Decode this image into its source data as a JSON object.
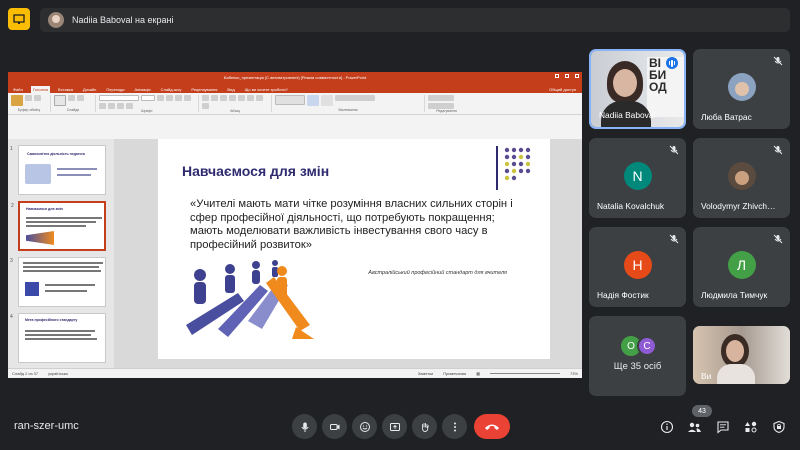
{
  "header": {
    "presenting_text": "Nadiia Baboval на екрані"
  },
  "ppt": {
    "window_title": "Бабенко_презентація (С автовзтровлені) [Режим совместности] - PowerPoint",
    "tabs": [
      "Файл",
      "Головна",
      "Вставка",
      "Дизайн",
      "Переходи",
      "Анімація",
      "Слайд-шоу",
      "Рецензування",
      "Вид",
      "Що ви хочете зробити?"
    ],
    "share_label": "Общий доступ",
    "groups": [
      "Буфер обміну",
      "Слайди",
      "Шрифт",
      "Абзац",
      "Малювання",
      "Редагування"
    ],
    "slide_title": "Навчаємося для змін",
    "slide_quote": "«Учителі мають мати чітке розуміння власних сильних сторін і сфер професійної діяльності, що потребують покращення; мають моделювати важливість інвестування свого часу в професійний розвиток»",
    "slide_cite": "Австралійський професійний стандарт для вчителя",
    "thumb_titles": [
      "Самоосвітня діяльність педагога",
      "Навчаємося для змін",
      "",
      "Мета професійного стандарту"
    ],
    "thumb_numbers": [
      "1",
      "2",
      "3",
      "4"
    ],
    "status_left": "Слайд 2 из 37",
    "status_lang": "українська",
    "status_notes": "Заметки",
    "status_comments": "Примечания",
    "zoom": "73%"
  },
  "participants": {
    "presenter": "Nadiia Baboval",
    "others": [
      {
        "name": "Люба Ватрас",
        "photo": true
      },
      {
        "name": "Natalia Kovalchuk",
        "initial": "N",
        "color": "#00897b"
      },
      {
        "name": "Volodymyr Zhivch…",
        "photo": true
      },
      {
        "name": "Надія Фостик",
        "initial": "Н",
        "color": "#e64a19"
      },
      {
        "name": "Людмила Тимчук",
        "initial": "Л",
        "color": "#43a047"
      }
    ],
    "more_label": "Ще 35 осіб",
    "more_initials": [
      {
        "initial": "O",
        "color": "#43a047"
      },
      {
        "initial": "C",
        "color": "#8e5bd4"
      }
    ],
    "self_label": "Ви"
  },
  "bottom_bar": {
    "meeting_code": "ran-szer-umc",
    "participant_count": "43",
    "controls": [
      "mic-icon",
      "camera-icon",
      "emoji-icon",
      "present-icon",
      "raise-hand-icon",
      "more-icon",
      "end-call-icon"
    ],
    "right_icons": [
      "info-icon",
      "people-icon",
      "chat-icon",
      "activities-icon",
      "host-controls-icon"
    ]
  }
}
